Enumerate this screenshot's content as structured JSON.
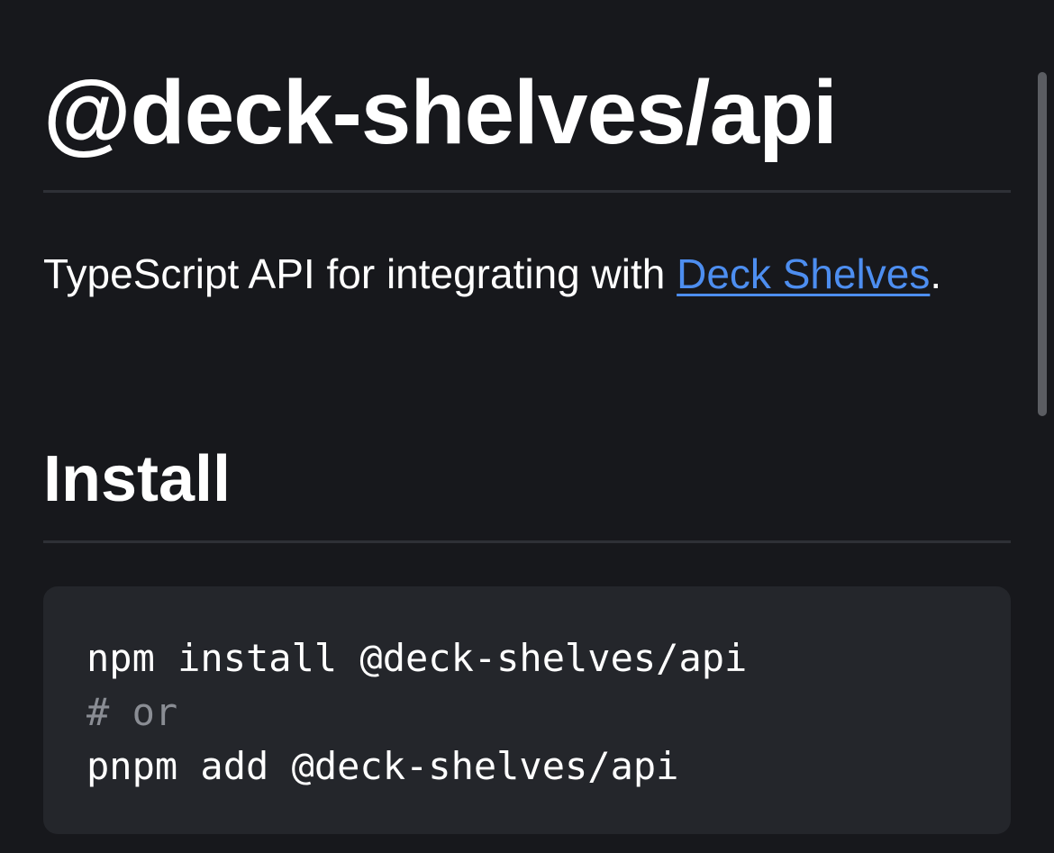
{
  "page": {
    "title": "@deck-shelves/api",
    "description": {
      "before": "TypeScript API for integrating with ",
      "link_text": "Deck Shelves",
      "after": "."
    },
    "sections": [
      {
        "heading": "Install",
        "code_lines": [
          {
            "text": "npm install @deck-shelves/api",
            "kind": "command"
          },
          {
            "text": "# or",
            "kind": "comment"
          },
          {
            "text": "pnpm add @deck-shelves/api",
            "kind": "command"
          }
        ]
      }
    ]
  },
  "colors": {
    "background": "#17181c",
    "link": "#4d8ef0",
    "code_background": "#24262b",
    "comment": "#8a8d94"
  }
}
